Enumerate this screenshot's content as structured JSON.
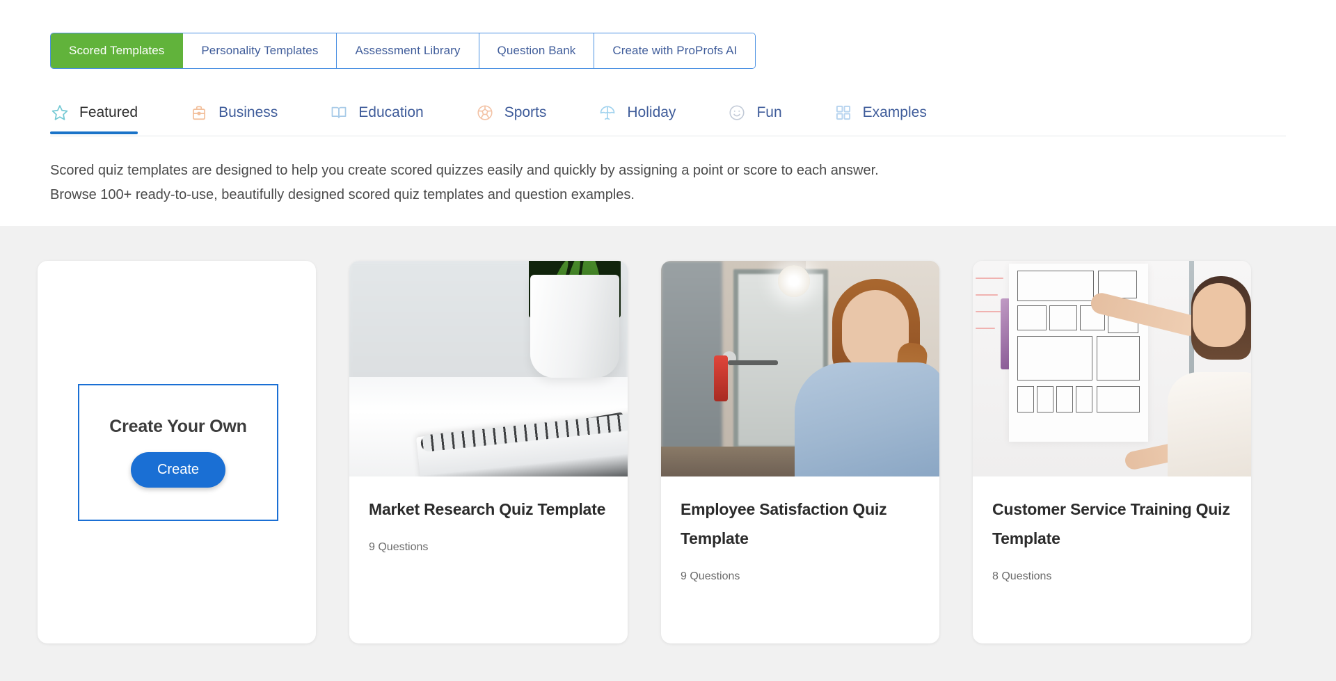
{
  "tabs": [
    {
      "label": "Scored Templates",
      "active": true
    },
    {
      "label": "Personality Templates",
      "active": false
    },
    {
      "label": "Assessment Library",
      "active": false
    },
    {
      "label": "Question Bank",
      "active": false
    },
    {
      "label": "Create with ProProfs AI",
      "active": false
    }
  ],
  "categories": [
    {
      "label": "Featured",
      "icon": "star-icon",
      "active": true
    },
    {
      "label": "Business",
      "icon": "briefcase-icon",
      "active": false
    },
    {
      "label": "Education",
      "icon": "book-icon",
      "active": false
    },
    {
      "label": "Sports",
      "icon": "soccer-ball-icon",
      "active": false
    },
    {
      "label": "Holiday",
      "icon": "beach-umbrella-icon",
      "active": false
    },
    {
      "label": "Fun",
      "icon": "smiley-icon",
      "active": false
    },
    {
      "label": "Examples",
      "icon": "grid-icon",
      "active": false
    }
  ],
  "description": {
    "line1": "Scored quiz templates are designed to help you create scored quizzes easily and quickly by assigning a point or score to each answer.",
    "line2": "Browse 100+ ready-to-use, beautifully designed scored quiz templates and question examples."
  },
  "create_card": {
    "title": "Create Your Own",
    "button_label": "Create"
  },
  "templates": [
    {
      "title": "Market Research Quiz Template",
      "questions": "9 Questions",
      "image_alt": "desk-with-notebook-and-plant"
    },
    {
      "title": "Employee Satisfaction Quiz Template",
      "questions": "9 Questions",
      "image_alt": "smiling-woman-in-office-doorway"
    },
    {
      "title": "Customer Service Training Quiz Template",
      "questions": "8 Questions",
      "image_alt": "woman-pointing-at-whiteboard-wireframes"
    }
  ],
  "colors": {
    "active_tab_green": "#61b33b",
    "tab_border_blue": "#4a90e2",
    "link_blue": "#3f5c9a",
    "accent_blue": "#1a6fd4",
    "underline_blue": "#1a73c8",
    "page_gray": "#f1f1f1",
    "star_teal": "#74c9d4",
    "icon_orange": "#f2bf9b"
  }
}
